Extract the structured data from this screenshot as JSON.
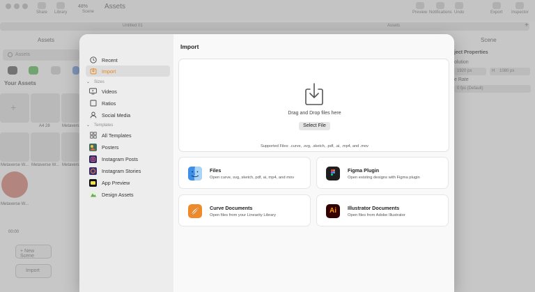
{
  "app": {
    "title": "Assets",
    "zoom": "48%",
    "tabs": [
      "Untitled 01",
      "Assets"
    ],
    "left_header": "Assets",
    "right_header": "Scene",
    "search_placeholder": "Assets",
    "your_assets": "Your Assets",
    "asset_thumbs": [
      "A4 28",
      "Metavers",
      "Metaverse W...",
      "Metaverse W...",
      "Metavers",
      "Metaverse W..."
    ],
    "scene_time": "00:00",
    "new_scene_label": "+ New Scene",
    "import_label": "Import",
    "right_props": {
      "section": "ject Properties",
      "resolution_label": "olution",
      "width": "1920 px",
      "height_prefix": "H",
      "height": "1080 px",
      "frame_rate_label": "e Rate",
      "frame_rate": "0 fps (Default)"
    },
    "toolbar_labels": [
      "Share",
      "Library",
      "Scene",
      "Preview",
      "Notifications",
      "Undo",
      "Export",
      "Inspector"
    ]
  },
  "sidebar": {
    "items_top": [
      {
        "label": "Recent",
        "icon": "clock-icon",
        "active": false
      },
      {
        "label": "Import",
        "icon": "import-icon",
        "active": true
      }
    ],
    "sizes_header": "Sizes",
    "sizes": [
      {
        "label": "Videos",
        "icon": "monitor-icon"
      },
      {
        "label": "Ratios",
        "icon": "square-icon"
      },
      {
        "label": "Social Media",
        "icon": "person-icon"
      }
    ],
    "templates_header": "Templates",
    "templates": [
      {
        "label": "All Templates",
        "icon": "grid-icon"
      },
      {
        "label": "Posters",
        "icon": "posters-icon"
      },
      {
        "label": "Instagram Posts",
        "icon": "instagram-posts-icon"
      },
      {
        "label": "Instagram Stories",
        "icon": "instagram-stories-icon"
      },
      {
        "label": "App Preview",
        "icon": "app-preview-icon"
      },
      {
        "label": "Design Assets",
        "icon": "design-assets-icon"
      }
    ]
  },
  "main": {
    "title": "Import",
    "dropzone": {
      "icon": "download-tray-icon",
      "text": "Drag and Drop files here",
      "button": "Select File",
      "supported": "Supported Files: .curve, .svg, .sketch, .pdf, .ai, .mp4, and .mov"
    },
    "cards": [
      {
        "title": "Files",
        "subtitle": "Open curve, svg, sketch, pdf, ai, mp4, and mov",
        "icon": "finder-icon"
      },
      {
        "title": "Figma Plugin",
        "subtitle": "Open existing designs with Figma plugin",
        "icon": "figma-icon"
      },
      {
        "title": "Curve Documents",
        "subtitle": "Open files from your Linearity Library",
        "icon": "curve-icon"
      },
      {
        "title": "Illustrator Documents",
        "subtitle": "Open files from Adobe Illustrator",
        "icon": "illustrator-icon",
        "icon_text": "Ai"
      }
    ]
  },
  "colors": {
    "accent": "#e9861c",
    "modal_bg": "#f9f9f9",
    "sidebar_bg": "#ededed"
  }
}
